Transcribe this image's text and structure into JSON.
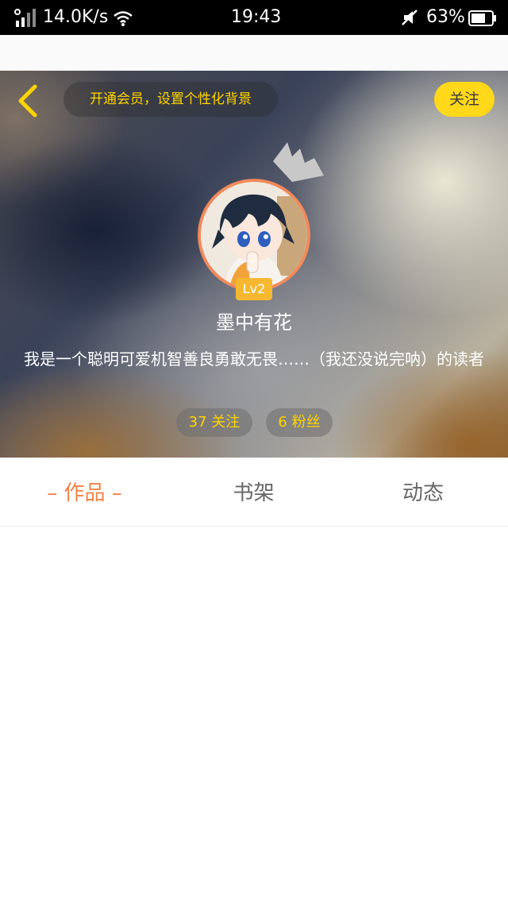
{
  "status_bar": {
    "network_speed": "14.0K/s",
    "time": "19:43",
    "battery_percent": "63%",
    "icons": [
      "signal-icon",
      "wifi-icon",
      "mute-icon",
      "battery-icon"
    ]
  },
  "header": {
    "vip_banner": "开通会员，设置个性化背景",
    "follow_label": "关注"
  },
  "profile": {
    "level": "Lv2",
    "username": "墨中有花",
    "bio": "我是一个聪明可爱机智善良勇敢无畏……（我还没说完呐）的读者",
    "following": "37 关注",
    "fans": "6 粉丝"
  },
  "tabs": [
    {
      "label": "– 作品 –",
      "active": true
    },
    {
      "label": "书架",
      "active": false
    },
    {
      "label": "动态",
      "active": false
    }
  ],
  "colors": {
    "accent_yellow": "#ffd400",
    "follow_button": "#ffd81a",
    "avatar_ring": "#f08a5b",
    "level_badge": "#f5b830",
    "active_tab": "#f08248"
  }
}
